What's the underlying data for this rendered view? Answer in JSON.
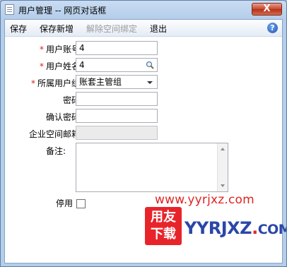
{
  "window": {
    "title": "用户管理 -- 网页对话框",
    "close_label": "X"
  },
  "toolbar": {
    "save": "保存",
    "save_new": "保存新增",
    "unbind_space": "解除空间绑定",
    "exit": "退出",
    "help": "?"
  },
  "form": {
    "account_label": "用户账号:",
    "account_value": "4",
    "name_label": "用户姓名:",
    "name_value": "4",
    "group_label": "所属用户组:",
    "group_value": "账套主管组",
    "password_label": "密码:",
    "password_value": "",
    "confirm_label": "确认密码:",
    "confirm_value": "",
    "email_label": "企业空间邮箱:",
    "email_value": "",
    "remark_label": "备注:",
    "disable_label": "停用",
    "disabled_checked": false,
    "required_mark": "*"
  },
  "watermark": {
    "url": "www.yyrjxz.com",
    "badge_top": "用友",
    "badge_bottom": "下载",
    "brand": "YYRJXZ",
    "dot": ".",
    "tld": "COM"
  }
}
